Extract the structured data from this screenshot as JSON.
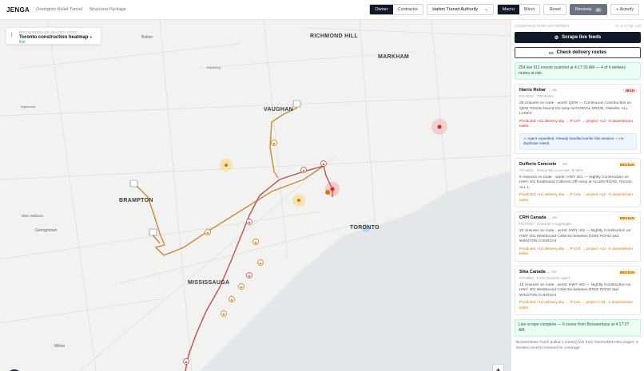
{
  "header": {
    "brand": "JENGA",
    "project": "Ossington Relief Tunnel",
    "package": "Structural Package",
    "view_owner": "Owner",
    "view_contractor": "Contractor",
    "authority": "Halton Transit Authority",
    "mode_macro": "Macro",
    "mode_micro": "Micro",
    "reset": "Reset",
    "reviews": "Reviews",
    "reviews_count": "0",
    "activity": "+ Activity"
  },
  "map": {
    "feed_kicker": "BROWSERBASE MACRO FEED",
    "feed_title": "Toronto construction heatmap",
    "feed_live": "● live",
    "labels": {
      "bolton": "Bolton",
      "richmond_hill": "RICHMOND HILL",
      "markham": "MARKHAM",
      "kleinburg": "Kleinburg",
      "vaughan": "VAUGHAN",
      "inglewood": "Inglewood",
      "brampton": "BRAMPTON",
      "glen_williams": "Glen Williams",
      "georgetown": "Georgetown",
      "toronto": "TORONTO",
      "mississauga": "MISSISSAUGA",
      "milton": "Milton"
    },
    "zoom_in": "+",
    "zoom_out": "−",
    "logo": "N"
  },
  "panel": {
    "section": "CONSTRUCTION HOTZONES",
    "time": "⟳ 4:27:31 AM",
    "scrape_btn": "Scrape live feeds",
    "check_btn": "Check delivery routes",
    "scan_notice": "254 live 511 events scanned at 4:17:30 AM — 4 of 4 delivery routes at risk.",
    "risks": [
      {
        "name": "Harris Rebar",
        "site": "→ site",
        "level": "HIGH",
        "po": "PO-8934 · TIM Rebar",
        "body": "39 closures on route · worst: QEW — Continuous Construction on QEW Toronto bound On-ramp at DORVAL DRIVE, Oakville. ALL LANES",
        "pred": "Predicted +2d delivery slip → P-107 → project +1d · 6 downstream tasks",
        "agent": "⚠ Agent expedited: Already handled earlier this session — no duplicate raised."
      },
      {
        "name": "Dufferin Concrete",
        "site": "→ site",
        "level": "MEDIUM",
        "po": "PO-8821 · Ready-Mix Concrete 35 MPa",
        "body": "8 closures on route · worst: HWY 401 — Nightly Construction on HWY 401 Eastbound Collector Off-ramp at ALLEN ROAD, Toronto. ALL L",
        "pred": "Predicted +1d delivery slip → P-104 → project +1d · 5 downstream tasks"
      },
      {
        "name": "CRH Canada",
        "site": "→ site",
        "level": "MEDIUM",
        "po": "PO-8840 · Granular A Aggregate",
        "body": "22 closures on route · worst: HWY 401 — Nightly Construction on HWY 401 Westbound Collector between DIXIE ROAD and WINSTON CHURCHI",
        "pred": "Predicted +1d delivery slip → P-103 → project +1d · 6 downstream tasks"
      },
      {
        "name": "Sika Canada",
        "site": "→ site",
        "level": "MEDIUM",
        "po": "PO-8863 · Form Release Agent",
        "body": "16 closures on route · worst: HWY 401 — Nightly Construction on HWY 401 Westbound Collector between DIXIE ROAD and WINSTON CHURCHI",
        "pred": "Predicted +1d delivery slip → P-112 → project +1d · 2 downstream tasks"
      }
    ],
    "scrape_notice": "Live scrape complete — 6 zones from Browserbase at 4:17:27 AM.",
    "footer": "Browserbase Fetch pulled 1 zone(s) live from TorontoMetrolinx pages; 5 seeded zone(s) retained for coverage."
  },
  "colors": {
    "route_orange": "#c98a3a",
    "route_red": "#c0504d",
    "high": "#b91c1c",
    "medium": "#b45309"
  }
}
